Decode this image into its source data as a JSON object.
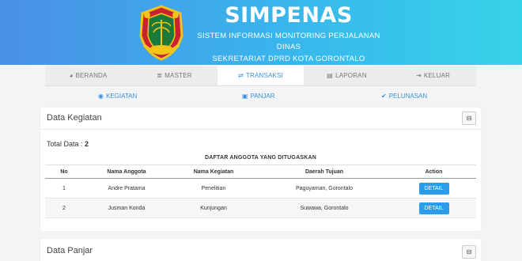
{
  "header": {
    "title": "SIMPENAS",
    "subtitle_line1": "SISTEM INFORMASI MONITORING PERJALANAN DINAS",
    "subtitle_line2": "SEKRETARIAT DPRD KOTA GORONTALO"
  },
  "nav": [
    {
      "label": "BERANDA",
      "icon": "dashboard-icon",
      "active": false
    },
    {
      "label": "MASTER",
      "icon": "database-icon",
      "active": false
    },
    {
      "label": "TRANSAKSI",
      "icon": "exchange-icon",
      "active": true
    },
    {
      "label": "LAPORAN",
      "icon": "file-icon",
      "active": false
    },
    {
      "label": "KELUAR",
      "icon": "logout-icon",
      "active": false
    }
  ],
  "subnav": [
    {
      "label": "KEGIATAN",
      "icon": "lightbulb-icon"
    },
    {
      "label": "PANJAR",
      "icon": "money-icon"
    },
    {
      "label": "PELUNASAN",
      "icon": "check-icon"
    }
  ],
  "kegiatan_card": {
    "title": "Data Kegiatan",
    "total_label": "Total Data :",
    "total_value": "2",
    "table_caption": "DAFTAR ANGGOTA YANG DITUGASKAN",
    "columns": [
      "No",
      "Nama Anggota",
      "Nama Kegiatan",
      "Daerah Tujuan",
      "Action"
    ],
    "rows": [
      {
        "no": "1",
        "nama": "Andre Pratama",
        "kegiatan": "Penelitian",
        "tujuan": "Paguyaman, Gorontalo",
        "action": "DETAIL"
      },
      {
        "no": "2",
        "nama": "Jusman Konda",
        "kegiatan": "Kunjungan",
        "tujuan": "Suwawa, Gorontalo",
        "action": "DETAIL"
      }
    ]
  },
  "panjar_card": {
    "title": "Data Panjar"
  },
  "colors": {
    "header_start": "#4a8fe6",
    "header_end": "#37d3e9",
    "accent": "#3b8fd9",
    "button": "#2b9ce8"
  }
}
